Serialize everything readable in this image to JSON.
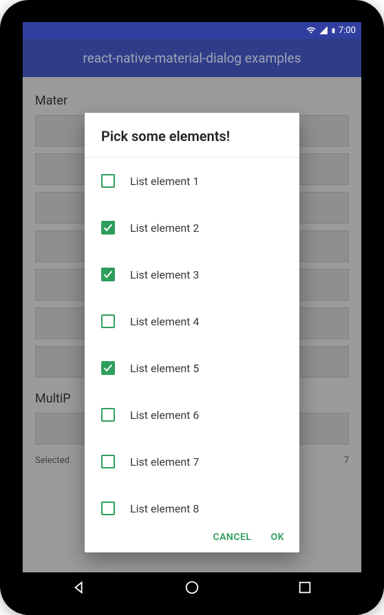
{
  "status": {
    "time": "7:00"
  },
  "titlebar": {
    "title": "react-native-material-dialog examples"
  },
  "background": {
    "section1_label": "Mater",
    "section2_label": "MultiP",
    "selected_text_left": "Selected",
    "selected_text_right": "7"
  },
  "dialog": {
    "title": "Pick some elements!",
    "items": [
      {
        "label": "List element 1",
        "checked": false
      },
      {
        "label": "List element 2",
        "checked": true
      },
      {
        "label": "List element 3",
        "checked": true
      },
      {
        "label": "List element 4",
        "checked": false
      },
      {
        "label": "List element 5",
        "checked": true
      },
      {
        "label": "List element 6",
        "checked": false
      },
      {
        "label": "List element 7",
        "checked": false
      },
      {
        "label": "List element 8",
        "checked": false
      }
    ],
    "actions": {
      "cancel": "CANCEL",
      "ok": "OK"
    }
  },
  "colors": {
    "accent": "#2e9e5b",
    "primary": "#3f51b5",
    "primary_dark": "#303f9f"
  }
}
